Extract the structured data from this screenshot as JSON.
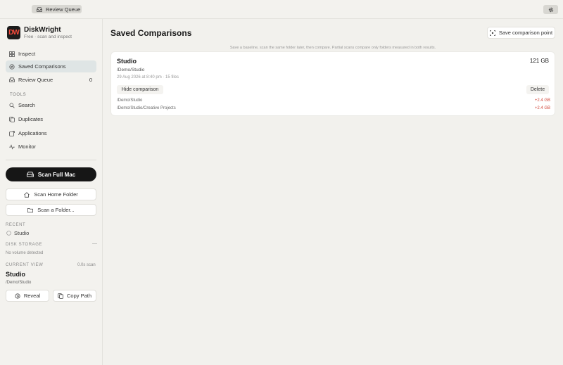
{
  "topbar": {
    "review_label": "Review Queue"
  },
  "app": {
    "name": "DiskWright",
    "subtitle": "Free · scan and inspect",
    "logo_text": "DW"
  },
  "nav": [
    {
      "label": "Inspect",
      "icon": "grid-icon"
    },
    {
      "label": "Saved Comparisons",
      "icon": "compare-icon",
      "active": true
    },
    {
      "label": "Review Queue",
      "icon": "inbox-icon",
      "count": "0"
    }
  ],
  "tools": {
    "heading": "TOOLS",
    "items": [
      {
        "label": "Search",
        "icon": "search-icon"
      },
      {
        "label": "Duplicates",
        "icon": "duplicate-icon"
      },
      {
        "label": "Applications",
        "icon": "applications-icon"
      },
      {
        "label": "Monitor",
        "icon": "pulse-icon"
      }
    ]
  },
  "scan": {
    "full_label": "Scan Full Mac",
    "home_label": "Scan Home Folder",
    "folder_label": "Scan a Folder..."
  },
  "recent": {
    "heading": "RECENT",
    "item": "Studio"
  },
  "disk": {
    "heading": "DISK STORAGE",
    "status": "No volume detected",
    "collapse": "—"
  },
  "current": {
    "heading": "CURRENT VIEW",
    "scan_time": "0.0s scan",
    "name": "Studio",
    "path": "/Demo/Studio",
    "reveal_label": "Reveal",
    "copy_label": "Copy Path"
  },
  "main": {
    "title": "Saved Comparisons",
    "save_label": "Save comparison point",
    "hint": "Save a baseline, scan the same folder later, then compare. Partial scans compare only folders measured in both results.",
    "card": {
      "title": "Studio",
      "size": "121 GB",
      "path": "/Demo/Studio",
      "date": "29 Aug 2026 at 8:40 pm · 15 files",
      "hide_label": "Hide comparison",
      "delete_label": "Delete",
      "rows": [
        {
          "path": "/Demo/Studio",
          "delta": "+2.4 GB"
        },
        {
          "path": "/Demo/Studio/Creative Projects",
          "delta": "+2.4 GB"
        }
      ]
    }
  },
  "colors": {
    "accent_delta": "#d24a3c",
    "logo_red": "#f14a3b",
    "active_nav": "#dfe5e5"
  }
}
